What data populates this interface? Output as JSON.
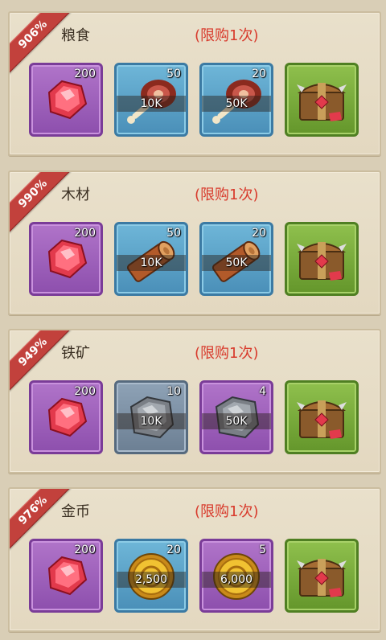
{
  "packs": [
    {
      "discount": "906%",
      "title": "粮食",
      "limit": "(限购1次)",
      "items": [
        {
          "icon": "ruby-gem-icon",
          "color": "purple",
          "count": "200",
          "amount": ""
        },
        {
          "icon": "meat-icon",
          "color": "blue",
          "count": "50",
          "amount": "10K"
        },
        {
          "icon": "meat-icon",
          "color": "blue",
          "count": "20",
          "amount": "50K"
        },
        {
          "icon": "treasure-chest-icon",
          "color": "green",
          "count": "",
          "amount": ""
        }
      ]
    },
    {
      "discount": "990%",
      "title": "木材",
      "limit": "(限购1次)",
      "items": [
        {
          "icon": "ruby-gem-icon",
          "color": "purple",
          "count": "200",
          "amount": ""
        },
        {
          "icon": "wood-log-icon",
          "color": "blue",
          "count": "50",
          "amount": "10K"
        },
        {
          "icon": "wood-log-icon",
          "color": "blue",
          "count": "20",
          "amount": "50K"
        },
        {
          "icon": "treasure-chest-icon",
          "color": "green",
          "count": "",
          "amount": ""
        }
      ]
    },
    {
      "discount": "949%",
      "title": "铁矿",
      "limit": "(限购1次)",
      "items": [
        {
          "icon": "ruby-gem-icon",
          "color": "purple",
          "count": "200",
          "amount": ""
        },
        {
          "icon": "iron-ore-icon",
          "color": "purple",
          "count": "10",
          "amount": "10K"
        },
        {
          "icon": "iron-ore-icon",
          "color": "purple",
          "count": "4",
          "amount": "50K"
        },
        {
          "icon": "treasure-chest-icon",
          "color": "green",
          "count": "",
          "amount": ""
        }
      ]
    },
    {
      "discount": "976%",
      "title": "金币",
      "limit": "(限购1次)",
      "items": [
        {
          "icon": "ruby-gem-icon",
          "color": "purple",
          "count": "200",
          "amount": ""
        },
        {
          "icon": "gold-coin-icon",
          "color": "blue",
          "count": "20",
          "amount": "2,500"
        },
        {
          "icon": "gold-coin-icon",
          "color": "purple",
          "count": "5",
          "amount": "6,000"
        },
        {
          "icon": "treasure-chest-icon",
          "color": "green",
          "count": "",
          "amount": ""
        }
      ]
    }
  ],
  "colors": {
    "ribbon": "#c2413c",
    "limit_text": "#d83a2c",
    "purple_slot": "#8d4fad",
    "blue_slot": "#4a8fb8",
    "green_slot": "#64962b"
  }
}
